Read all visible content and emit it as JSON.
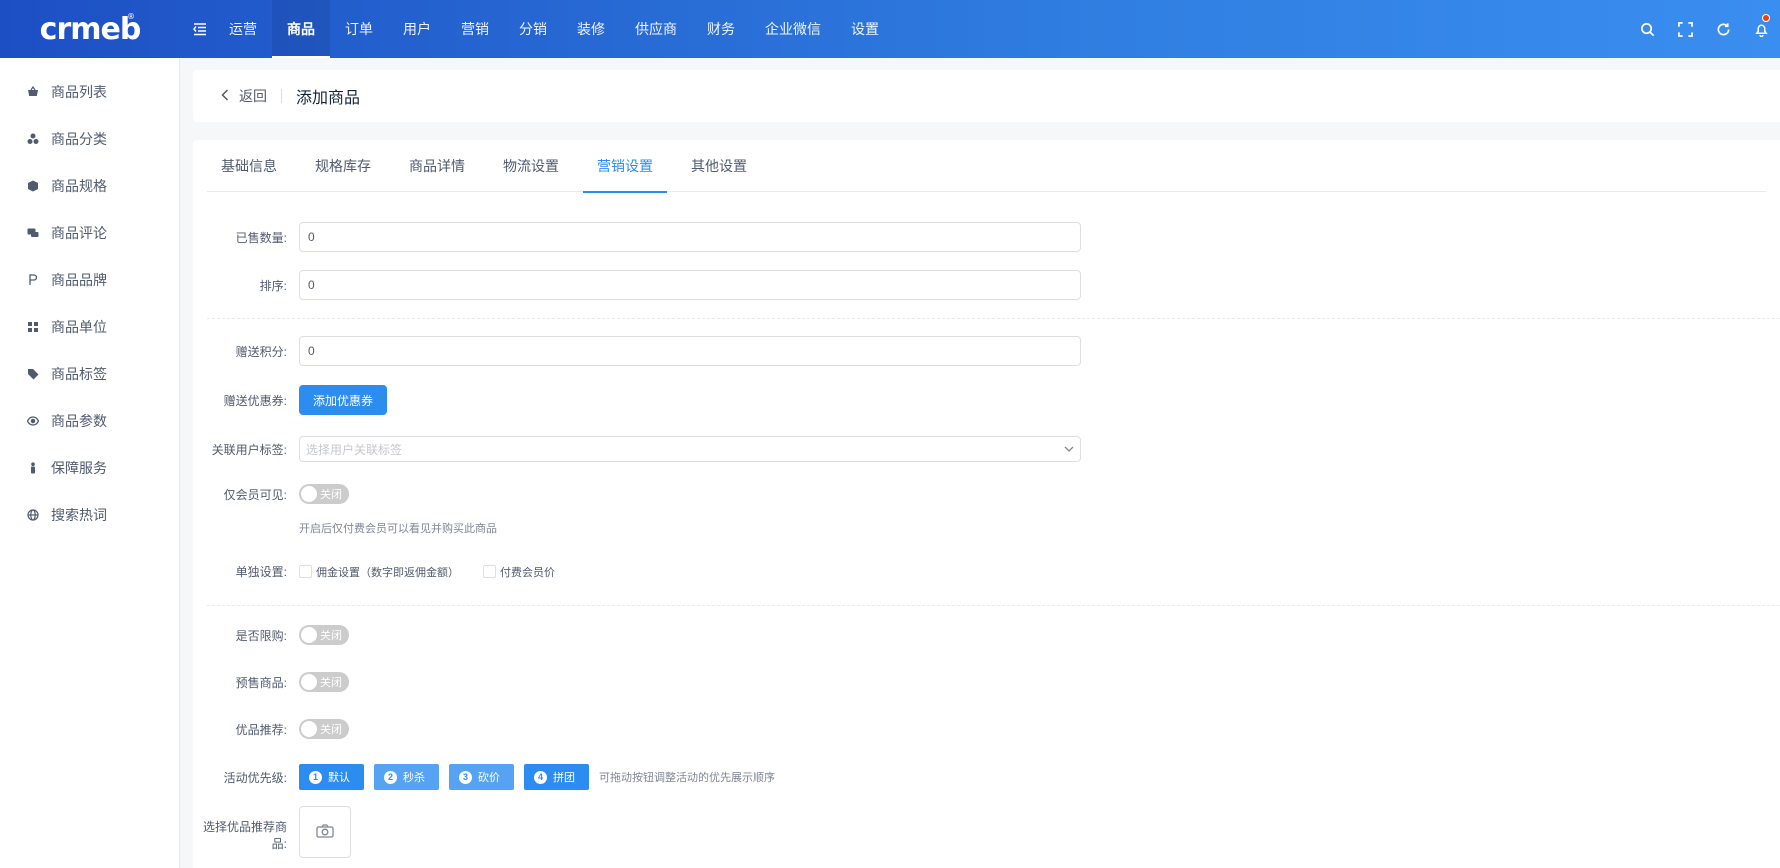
{
  "header": {
    "logo": "crmeb",
    "logo_mark": "®",
    "nav": [
      {
        "label": "运营",
        "active": false
      },
      {
        "label": "商品",
        "active": true
      },
      {
        "label": "订单",
        "active": false
      },
      {
        "label": "用户",
        "active": false
      },
      {
        "label": "营销",
        "active": false
      },
      {
        "label": "分销",
        "active": false
      },
      {
        "label": "装修",
        "active": false
      },
      {
        "label": "供应商",
        "active": false
      },
      {
        "label": "财务",
        "active": false
      },
      {
        "label": "企业微信",
        "active": false
      },
      {
        "label": "设置",
        "active": false
      }
    ],
    "icons": [
      "search-icon",
      "fullscreen-icon",
      "refresh-icon",
      "bell-icon"
    ]
  },
  "sidebar": {
    "items": [
      {
        "label": "商品列表",
        "icon": "basket-icon"
      },
      {
        "label": "商品分类",
        "icon": "category-icon"
      },
      {
        "label": "商品规格",
        "icon": "cube-icon"
      },
      {
        "label": "商品评论",
        "icon": "comment-icon"
      },
      {
        "label": "商品品牌",
        "icon": "brand-icon"
      },
      {
        "label": "商品单位",
        "icon": "grid-icon"
      },
      {
        "label": "商品标签",
        "icon": "tag-icon"
      },
      {
        "label": "商品参数",
        "icon": "eye-icon"
      },
      {
        "label": "保障服务",
        "icon": "person-icon"
      },
      {
        "label": "搜索热词",
        "icon": "globe-icon"
      }
    ]
  },
  "breadcrumb": {
    "back": "返回",
    "title": "添加商品"
  },
  "tabs": [
    {
      "label": "基础信息",
      "active": false
    },
    {
      "label": "规格库存",
      "active": false
    },
    {
      "label": "商品详情",
      "active": false
    },
    {
      "label": "物流设置",
      "active": false
    },
    {
      "label": "营销设置",
      "active": true
    },
    {
      "label": "其他设置",
      "active": false
    }
  ],
  "form": {
    "sold_label": "已售数量:",
    "sold_value": "0",
    "sort_label": "排序:",
    "sort_value": "0",
    "points_label": "赠送积分:",
    "points_value": "0",
    "coupon_label": "赠送优惠券:",
    "coupon_button": "添加优惠券",
    "tag_label": "关联用户标签:",
    "tag_placeholder": "选择用户关联标签",
    "member_label": "仅会员可见:",
    "member_switch": "关闭",
    "member_hint": "开启后仅付费会员可以看见并购买此商品",
    "single_label": "单独设置:",
    "single_opt1": "佣金设置（数字即返佣金额）",
    "single_opt2": "付费会员价",
    "limit_label": "是否限购:",
    "limit_switch": "关闭",
    "presale_label": "预售商品:",
    "presale_switch": "关闭",
    "recommend_label": "优品推荐:",
    "recommend_switch": "关闭",
    "priority_label": "活动优先级:",
    "priority_items": [
      {
        "num": "1",
        "label": "默认"
      },
      {
        "num": "2",
        "label": "秒杀"
      },
      {
        "num": "3",
        "label": "砍价"
      },
      {
        "num": "4",
        "label": "拼团"
      }
    ],
    "priority_hint": "可拖动按钮调整活动的优先展示顺序",
    "select_goods_label": "选择优品推荐商品:"
  },
  "colors": {
    "primary": "#2d8cf0",
    "header_start": "#1d4fc4",
    "header_end": "#3a8ef0",
    "badge": "#ed4014"
  }
}
